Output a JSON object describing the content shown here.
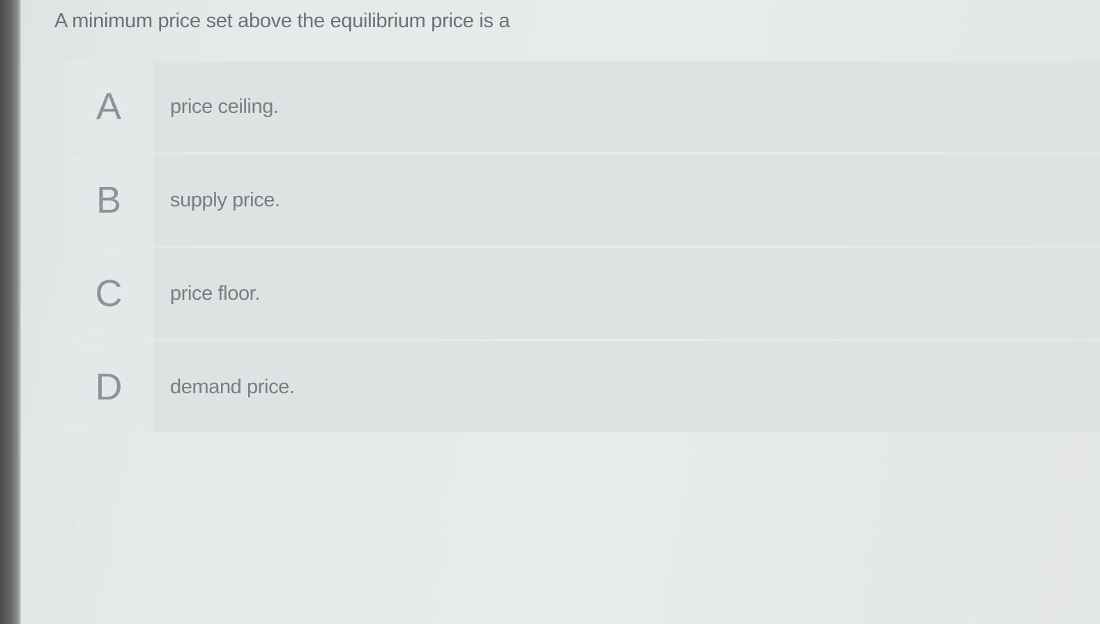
{
  "question": {
    "text": "A minimum price set above the equilibrium price is a"
  },
  "options": [
    {
      "letter": "A",
      "text": "price ceiling."
    },
    {
      "letter": "B",
      "text": "supply price."
    },
    {
      "letter": "C",
      "text": "price floor."
    },
    {
      "letter": "D",
      "text": "demand price."
    }
  ]
}
